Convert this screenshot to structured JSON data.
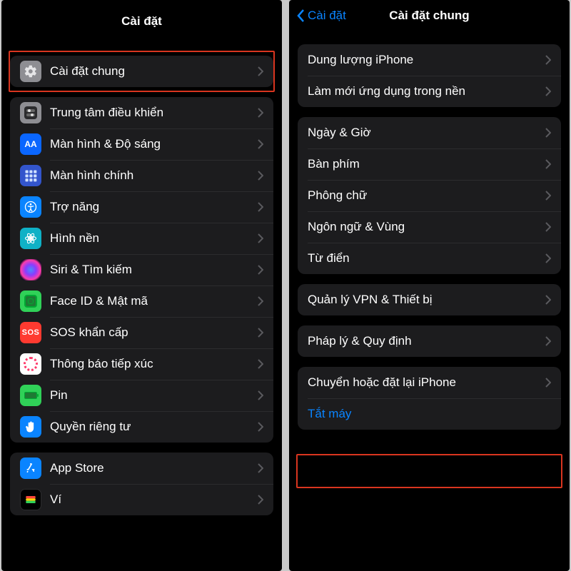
{
  "left": {
    "title": "Cài đặt",
    "group1": [
      {
        "name": "general",
        "label": "Cài đặt chung",
        "icon": "gear",
        "highlighted": true
      }
    ],
    "group2": [
      {
        "name": "control-center",
        "label": "Trung tâm điều khiển",
        "icon": "control"
      },
      {
        "name": "display",
        "label": "Màn hình & Độ sáng",
        "icon": "display",
        "iconText": "AA"
      },
      {
        "name": "home-screen",
        "label": "Màn hình chính",
        "icon": "apps"
      },
      {
        "name": "accessibility",
        "label": "Trợ năng",
        "icon": "access"
      },
      {
        "name": "wallpaper",
        "label": "Hình nền",
        "icon": "atom"
      },
      {
        "name": "siri",
        "label": "Siri & Tìm kiếm",
        "icon": "siri"
      },
      {
        "name": "faceid",
        "label": "Face ID & Mật mã",
        "icon": "face"
      },
      {
        "name": "sos",
        "label": "SOS khẩn cấp",
        "icon": "sos",
        "iconText": "SOS"
      },
      {
        "name": "exposure",
        "label": "Thông báo tiếp xúc",
        "icon": "expo"
      },
      {
        "name": "battery",
        "label": "Pin",
        "icon": "batt"
      },
      {
        "name": "privacy",
        "label": "Quyền riêng tư",
        "icon": "hand"
      }
    ],
    "group3": [
      {
        "name": "appstore",
        "label": "App Store",
        "icon": "appstore"
      },
      {
        "name": "wallet",
        "label": "Ví",
        "icon": "wallet"
      }
    ]
  },
  "right": {
    "back": "Cài đặt",
    "title": "Cài đặt chung",
    "group1": [
      {
        "name": "iphone-storage",
        "label": "Dung lượng iPhone"
      },
      {
        "name": "background-refresh",
        "label": "Làm mới ứng dụng trong nền"
      }
    ],
    "group2": [
      {
        "name": "date-time",
        "label": "Ngày & Giờ"
      },
      {
        "name": "keyboard",
        "label": "Bàn phím"
      },
      {
        "name": "fonts",
        "label": "Phông chữ"
      },
      {
        "name": "language-region",
        "label": "Ngôn ngữ & Vùng"
      },
      {
        "name": "dictionary",
        "label": "Từ điển"
      }
    ],
    "group3": [
      {
        "name": "vpn-device",
        "label": "Quản lý VPN & Thiết bị"
      }
    ],
    "group4": [
      {
        "name": "legal",
        "label": "Pháp lý & Quy định"
      }
    ],
    "group5": [
      {
        "name": "transfer-reset",
        "label": "Chuyển hoặc đặt lại iPhone",
        "highlighted": true
      },
      {
        "name": "shutdown",
        "label": "Tắt máy",
        "link": true,
        "noChevron": true
      }
    ]
  }
}
